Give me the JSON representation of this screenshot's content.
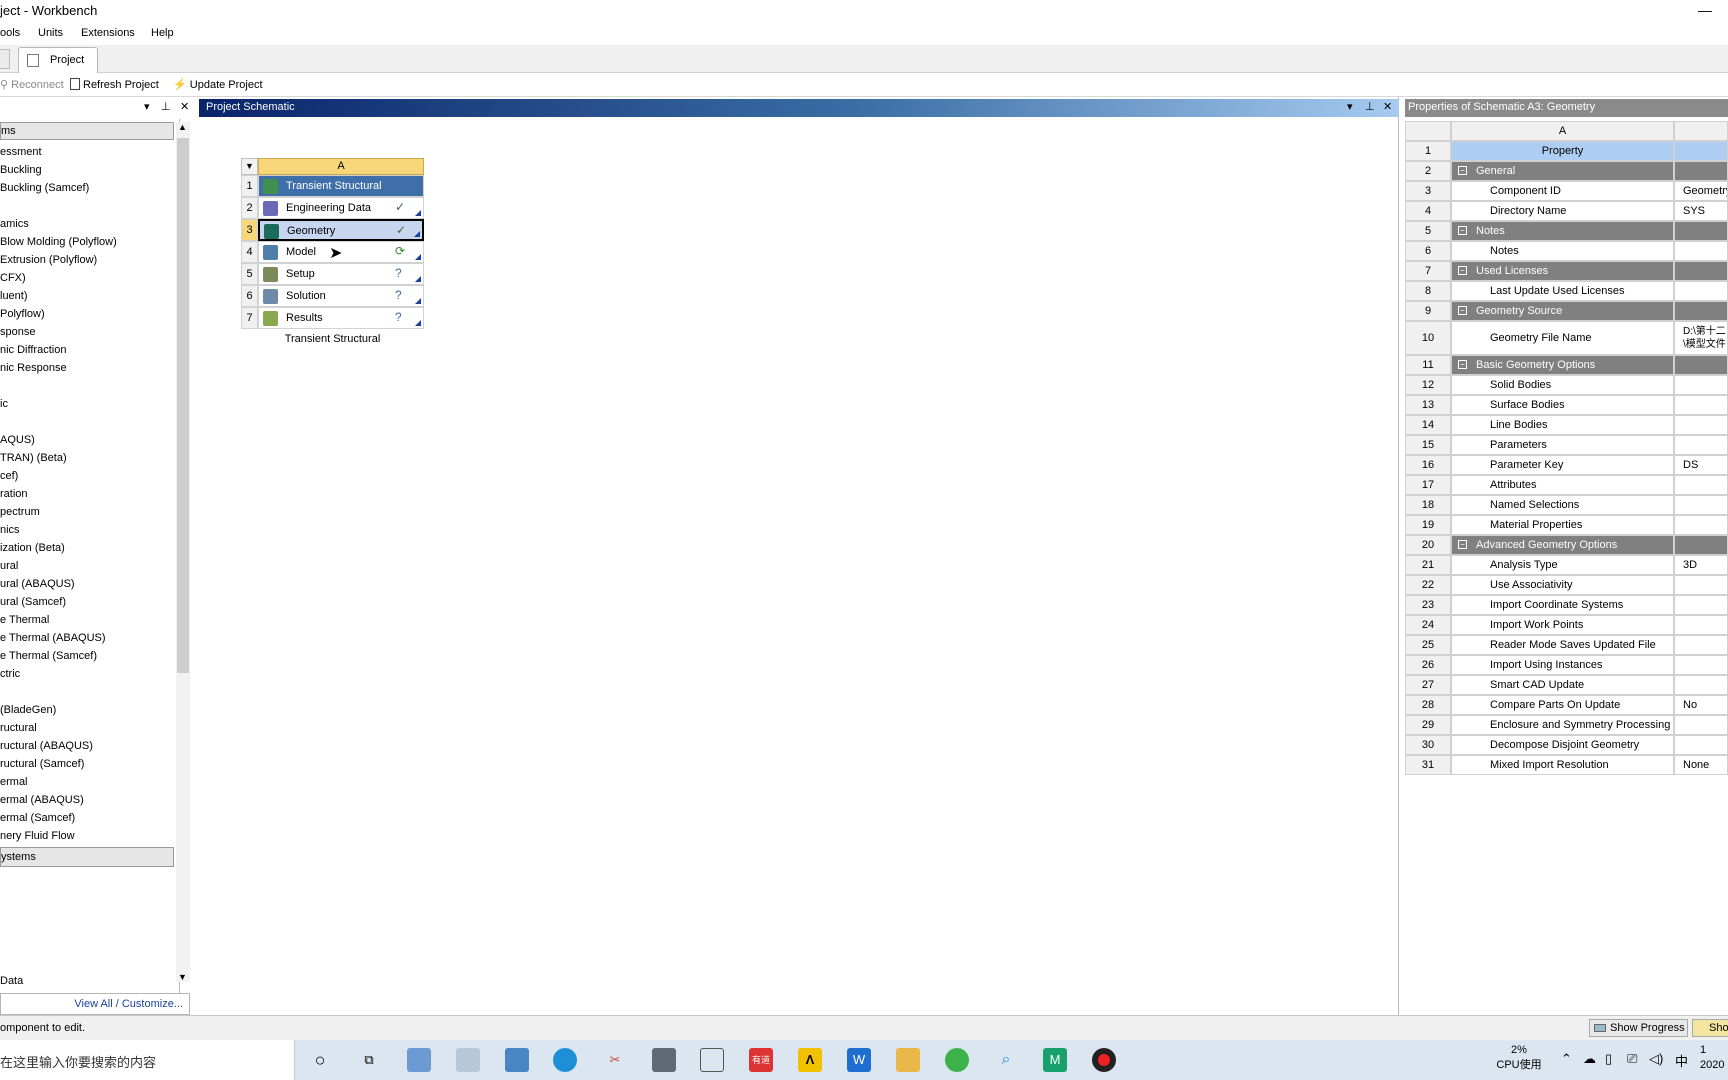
{
  "window": {
    "title": "ject - Workbench",
    "minimize": "—"
  },
  "menu": [
    "ools",
    "Units",
    "Extensions",
    "Help"
  ],
  "tabs": {
    "project": "Project"
  },
  "toolbar": {
    "reconnect": "Reconnect",
    "refresh": "Refresh Project",
    "update": "Update Project"
  },
  "toolbox": {
    "group1": "ms",
    "items": [
      "essment",
      "Buckling",
      "Buckling (Samcef)",
      "",
      "amics",
      "Blow Molding (Polyflow)",
      "Extrusion (Polyflow)",
      "CFX)",
      "luent)",
      "Polyflow)",
      "sponse",
      "nic Diffraction",
      "nic Response",
      "",
      "ic",
      "",
      "AQUS)",
      "TRAN) (Beta)",
      "cef)",
      "ration",
      "pectrum",
      "nics",
      "ization (Beta)",
      "ural",
      "ural (ABAQUS)",
      "ural (Samcef)",
      "e Thermal",
      "e Thermal (ABAQUS)",
      "e Thermal (Samcef)",
      "ctric",
      "",
      "(BladeGen)",
      "ructural",
      "ructural (ABAQUS)",
      "ructural (Samcef)",
      "ermal",
      "ermal (ABAQUS)",
      "ermal (Samcef)",
      "nery Fluid Flow"
    ],
    "group2": "ystems",
    "last": "Data",
    "view_all": "View All / Customize..."
  },
  "schematic": {
    "title": "Project Schematic",
    "column": "A",
    "caption": "Transient Structural",
    "rows": [
      {
        "num": "1",
        "label": "Transient Structural",
        "status": ""
      },
      {
        "num": "2",
        "label": "Engineering Data",
        "status": "✓"
      },
      {
        "num": "3",
        "label": "Geometry",
        "status": "✓"
      },
      {
        "num": "4",
        "label": "Model",
        "status": "⟳"
      },
      {
        "num": "5",
        "label": "Setup",
        "status": "?"
      },
      {
        "num": "6",
        "label": "Solution",
        "status": "?"
      },
      {
        "num": "7",
        "label": "Results",
        "status": "?"
      }
    ]
  },
  "properties": {
    "title": "Properties of Schematic A3: Geometry",
    "column": "A",
    "rows": [
      {
        "n": "1",
        "p": "Property",
        "v": "",
        "kind": "hdr"
      },
      {
        "n": "2",
        "p": "General",
        "v": "",
        "kind": "grp"
      },
      {
        "n": "3",
        "p": "Component ID",
        "v": "Geometry"
      },
      {
        "n": "4",
        "p": "Directory Name",
        "v": "SYS"
      },
      {
        "n": "5",
        "p": "Notes",
        "v": "",
        "kind": "grp"
      },
      {
        "n": "6",
        "p": "Notes",
        "v": ""
      },
      {
        "n": "7",
        "p": "Used Licenses",
        "v": "",
        "kind": "grp"
      },
      {
        "n": "8",
        "p": "Last Update Used Licenses",
        "v": ""
      },
      {
        "n": "9",
        "p": "Geometry Source",
        "v": "",
        "kind": "grp"
      },
      {
        "n": "10",
        "p": "Geometry File Name",
        "v": "D:\\第十二\n\\模型文件",
        "kind": "tall"
      },
      {
        "n": "11",
        "p": "Basic Geometry Options",
        "v": "",
        "kind": "grp"
      },
      {
        "n": "12",
        "p": "Solid Bodies",
        "v": ""
      },
      {
        "n": "13",
        "p": "Surface Bodies",
        "v": ""
      },
      {
        "n": "14",
        "p": "Line Bodies",
        "v": ""
      },
      {
        "n": "15",
        "p": "Parameters",
        "v": ""
      },
      {
        "n": "16",
        "p": "Parameter Key",
        "v": "DS"
      },
      {
        "n": "17",
        "p": "Attributes",
        "v": ""
      },
      {
        "n": "18",
        "p": "Named Selections",
        "v": ""
      },
      {
        "n": "19",
        "p": "Material Properties",
        "v": ""
      },
      {
        "n": "20",
        "p": "Advanced Geometry Options",
        "v": "",
        "kind": "grp"
      },
      {
        "n": "21",
        "p": "Analysis Type",
        "v": "3D"
      },
      {
        "n": "22",
        "p": "Use Associativity",
        "v": ""
      },
      {
        "n": "23",
        "p": "Import Coordinate Systems",
        "v": ""
      },
      {
        "n": "24",
        "p": "Import Work Points",
        "v": ""
      },
      {
        "n": "25",
        "p": "Reader Mode Saves Updated File",
        "v": ""
      },
      {
        "n": "26",
        "p": "Import Using Instances",
        "v": ""
      },
      {
        "n": "27",
        "p": "Smart CAD Update",
        "v": ""
      },
      {
        "n": "28",
        "p": "Compare Parts On Update",
        "v": "No"
      },
      {
        "n": "29",
        "p": "Enclosure and Symmetry Processing",
        "v": ""
      },
      {
        "n": "30",
        "p": "Decompose Disjoint Geometry",
        "v": ""
      },
      {
        "n": "31",
        "p": "Mixed Import Resolution",
        "v": "None"
      }
    ]
  },
  "status": {
    "message": "omponent to edit.",
    "show_progress": "Show Progress",
    "show2": "Sho"
  },
  "taskbar": {
    "search": "在这里输入你要搜索的内容",
    "cpu_pct": "2%",
    "cpu_label": "CPU使用",
    "ime": "中",
    "clock_top": "1",
    "clock_bottom": "2020"
  },
  "colors": {
    "accent": "#0a246a",
    "group": "#808080",
    "highlight": "#aecdf3"
  }
}
